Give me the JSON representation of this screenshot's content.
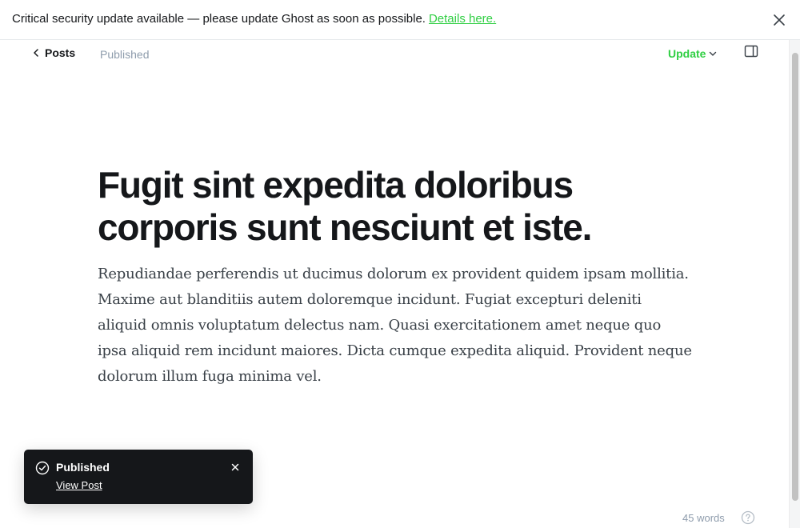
{
  "banner": {
    "message": "Critical security update available — please update Ghost as soon as possible.",
    "link_label": "Details here.",
    "close_icon": "close-icon"
  },
  "header": {
    "back_label": "Posts",
    "back_icon": "chevron-left-icon",
    "status": "Published",
    "update_label": "Update",
    "update_icon": "chevron-down-icon",
    "sidebar_icon": "sidebar-toggle-icon"
  },
  "post": {
    "title": "Fugit sint expedita doloribus corporis sunt nesciunt et iste.",
    "body": "Repudiandae perferendis ut ducimus dolorum ex provident quidem ipsam mollitia. Maxime aut blanditiis autem doloremque incidunt. Fugiat excepturi deleniti aliquid omnis voluptatum delectus nam. Quasi exercitationem amet neque quo ipsa aliquid rem incidunt maiores. Dicta cumque expedita aliquid. Provident neque dolorum illum fuga minima vel."
  },
  "toast": {
    "title": "Published",
    "link_label": "View Post",
    "icon": "check-circle-icon",
    "close_icon": "close-icon"
  },
  "footer": {
    "word_count": "45 words",
    "help_icon": "help-icon"
  },
  "colors": {
    "accent": "#30cf43",
    "text": "#15171a",
    "muted": "#8e9cac",
    "toast_bg": "#15171a"
  }
}
